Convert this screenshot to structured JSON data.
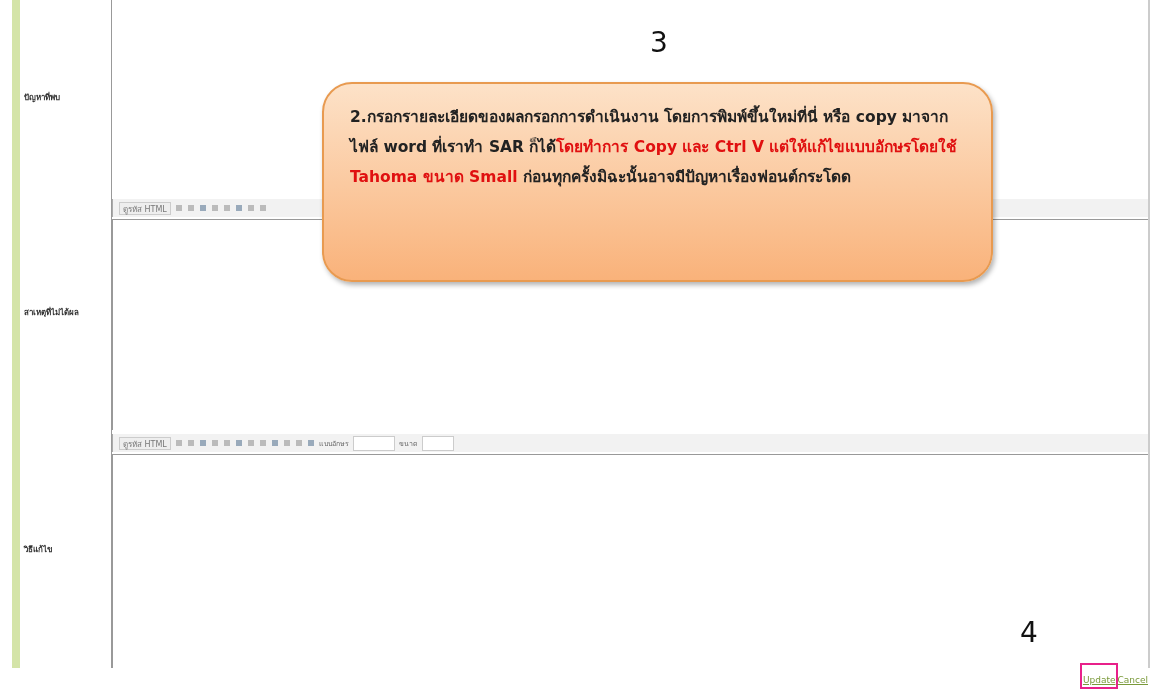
{
  "rows": [
    {
      "label": "ปัญหาที่พบ",
      "toolbar": null
    },
    {
      "label": "สาเหตุที่ไม่ได้ผล",
      "toolbar": {
        "html_button": "ดูรหัส HTML"
      }
    },
    {
      "label": "วิธีแก้ไข",
      "toolbar": {
        "html_button": "ดูรหัส HTML",
        "font_label": "แบบอักษร",
        "size_label": "ขนาด"
      }
    }
  ],
  "step_numbers": [
    "3",
    "4"
  ],
  "callout": {
    "segments": [
      {
        "kind": "normal",
        "text": "2.กรอกรายละเอียดของผลกรอกการดำเนินงาน โดยการพิมพ์ขึ้นใหม่ที่นี่ หรือ copy มาจากไฟล์ word ที่เราทำ SAR ก็ได้"
      },
      {
        "kind": "highlight",
        "text": "โดยทำการ Copy และ Ctrl V แต่ให้แก้ไขแบบอักษรโดยใช้ Tahoma ขนาด Small"
      },
      {
        "kind": "normal",
        "text": " ก่อนทุกครั้งมิฉะนั้นอาจมีปัญหาเรื่องฟอนต์กระโดด"
      }
    ]
  },
  "links": [
    "Update",
    "Cancel"
  ]
}
